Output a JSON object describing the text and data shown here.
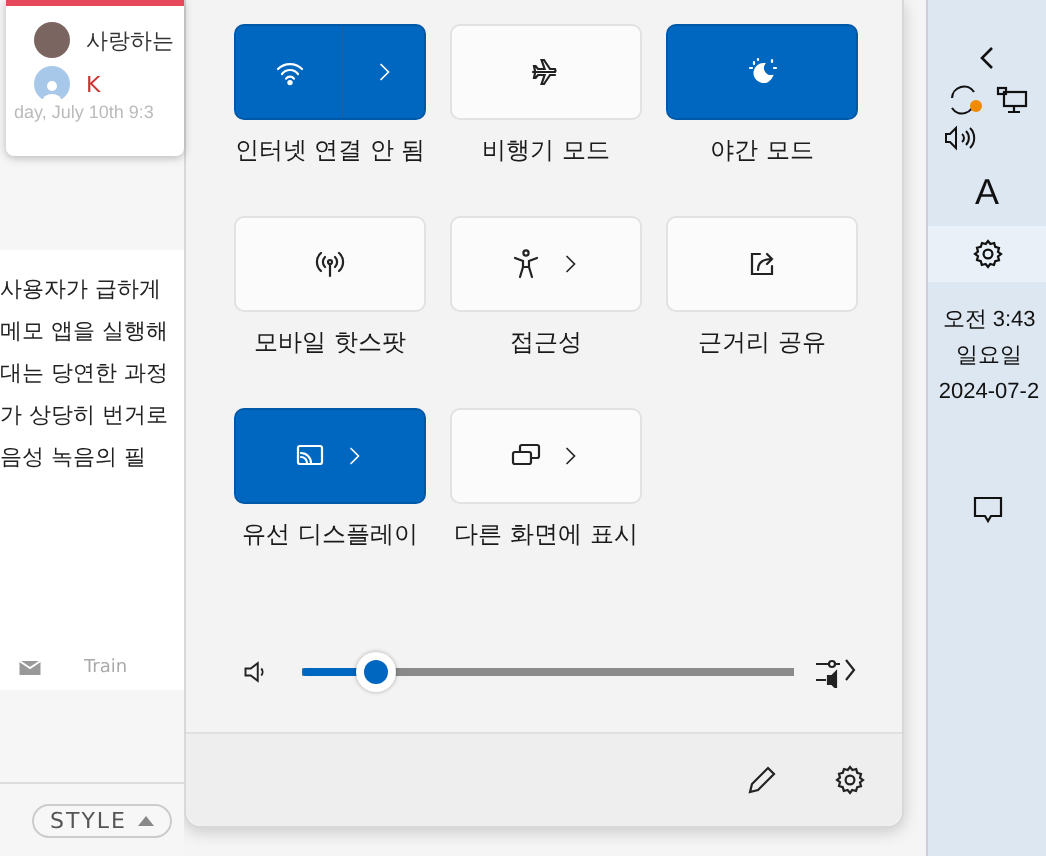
{
  "background_app": {
    "notifications": [
      {
        "name": "사랑하는",
        "kind": "photo"
      },
      {
        "name": "K",
        "kind": "person"
      }
    ],
    "timestamp": "day, July 10th 9:3",
    "body_lines": [
      "사용자가 급하게",
      "메모 앱을 실행해",
      "대는 당연한 과정",
      "가 상당히 번거로",
      "음성 녹음의 필"
    ],
    "footer_label": "Train",
    "style_button": "STYLE"
  },
  "quick_settings": {
    "tiles": [
      {
        "label": "인터넷 연결 안 됨",
        "kind": "wifi",
        "on": true,
        "split": true,
        "chevron": true
      },
      {
        "label": "비행기 모드",
        "kind": "airplane",
        "on": false,
        "split": false,
        "chevron": false
      },
      {
        "label": "야간 모드",
        "kind": "night",
        "on": true,
        "split": false,
        "chevron": false
      },
      {
        "label": "모바일 핫스팟",
        "kind": "hotspot",
        "on": false,
        "split": false,
        "chevron": false
      },
      {
        "label": "접근성",
        "kind": "accessibility",
        "on": false,
        "split": false,
        "chevron": true
      },
      {
        "label": "근거리 공유",
        "kind": "share",
        "on": false,
        "split": false,
        "chevron": false
      },
      {
        "label": "유선 디스플레이",
        "kind": "cast",
        "on": true,
        "split": false,
        "chevron": true
      },
      {
        "label": "다른 화면에 표시",
        "kind": "project",
        "on": false,
        "split": false,
        "chevron": true
      }
    ],
    "volume": {
      "level": 0.15
    }
  },
  "taskbar": {
    "ime": "A",
    "time": "오전 3:43",
    "day": "일요일",
    "date": "2024-07-2"
  }
}
